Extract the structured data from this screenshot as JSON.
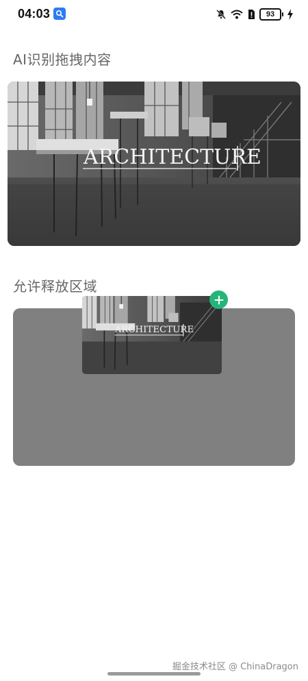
{
  "status_bar": {
    "time": "04:03",
    "notification_app_icon": "gallery-search-icon",
    "icons": [
      "mute-bell-icon",
      "wifi-icon",
      "sim-alert-icon"
    ],
    "battery_level": "93",
    "charging": true
  },
  "sections": {
    "source_title": "AI识别拖拽内容",
    "drop_title": "允许释放区域"
  },
  "source_image": {
    "caption": "ARCHITECTURE",
    "description_icon": "architecture-photo"
  },
  "drag_preview": {
    "caption": "ARCHITECTURE",
    "badge_icon": "plus-icon"
  },
  "colors": {
    "drop_zone": "#808080",
    "badge": "#25b57a",
    "title_text": "#666666"
  },
  "watermark": "掘金技术社区 @ ChinaDragon"
}
